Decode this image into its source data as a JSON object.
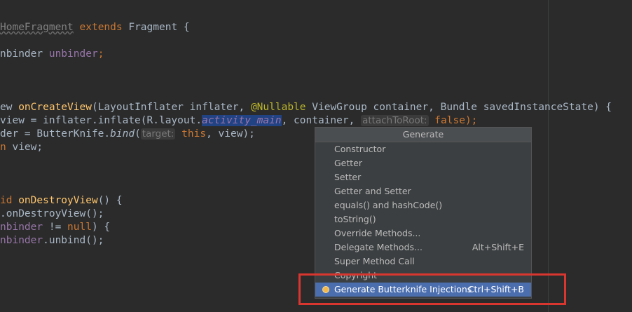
{
  "code": {
    "line1": {
      "class_name": "HomeFragment",
      "extends": "extends",
      "parent": "Fragment {"
    },
    "line2": {
      "type": "nbinder",
      "name": "unbinder",
      "semi": ";"
    },
    "line3": {
      "type": "ew",
      "method": "onCreateView",
      "p1": "(LayoutInflater inflater, ",
      "ann": "@Nullable",
      "p2": " ViewGroup container, Bundle savedInstanceState) {"
    },
    "line4": {
      "a": "view = inflater.inflate(R.layout.",
      "ref": "activity_main",
      "b": ", container, ",
      "hint": "attachToRoot:",
      "val": "false",
      "end": ");"
    },
    "line5": {
      "a": "der = ButterKnife.",
      "method": "bind",
      "b": "(",
      "hint": "target:",
      "this_kw": "this",
      "end": ", view);"
    },
    "line6": {
      "kw": "n",
      "rest": " view;"
    },
    "line7": {
      "kw": "id",
      "method": "onDestroyView",
      "rest": "() {"
    },
    "line8": {
      "a": ".onDestroyView();"
    },
    "line9": {
      "field": "nbinder",
      "a": " != ",
      "kw": "null",
      "b": ") {"
    },
    "line10": {
      "field": "nbinder",
      "a": ".unbind();"
    }
  },
  "generate_popup": {
    "title": "Generate",
    "items": [
      {
        "label": "Constructor",
        "shortcut": ""
      },
      {
        "label": "Getter",
        "shortcut": ""
      },
      {
        "label": "Setter",
        "shortcut": ""
      },
      {
        "label": "Getter and Setter",
        "shortcut": ""
      },
      {
        "label": "equals() and hashCode()",
        "shortcut": ""
      },
      {
        "label": "toString()",
        "shortcut": ""
      },
      {
        "label": "Override Methods...",
        "shortcut": ""
      },
      {
        "label": "Delegate Methods...",
        "shortcut": "Alt+Shift+E"
      },
      {
        "label": "Super Method Call",
        "shortcut": ""
      },
      {
        "label": "Copyright",
        "shortcut": ""
      },
      {
        "label": "Generate Butterknife Injections",
        "shortcut": "Ctrl+Shift+B",
        "icon": "butterknife-icon",
        "selected": true
      }
    ]
  },
  "colors": {
    "editor_bg": "#2b2b2b",
    "keyword": "#cc7832",
    "method": "#ffc66d",
    "selection": "#4b6eaf",
    "highlight_box": "#d9362f"
  }
}
